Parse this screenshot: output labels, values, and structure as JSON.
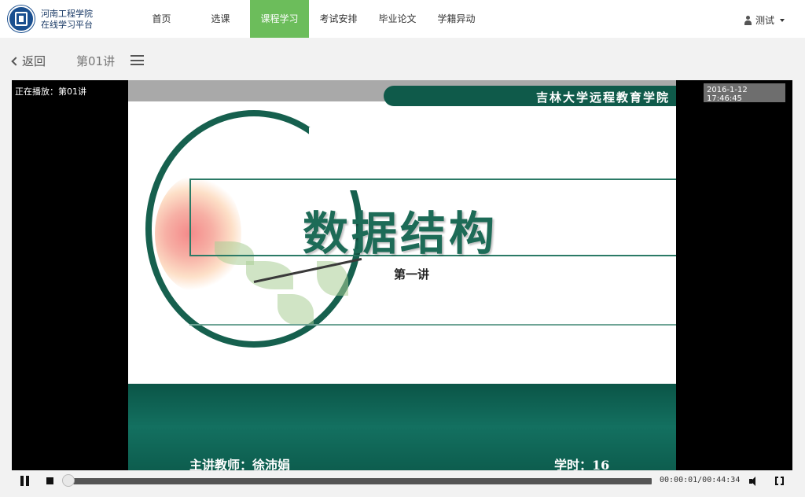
{
  "header": {
    "school_name_line1": "河南工程学院",
    "school_name_line2": "在线学习平台",
    "nav": [
      {
        "label": "首页"
      },
      {
        "label": "选课"
      },
      {
        "label": "课程学习",
        "active": true
      },
      {
        "label": "考试安排"
      },
      {
        "label": "毕业论文"
      },
      {
        "label": "学籍异动"
      }
    ],
    "user_name": "测试"
  },
  "subbar": {
    "back_label": "返回",
    "lecture_title": "第01讲"
  },
  "player": {
    "now_playing": "正在播放：第01讲",
    "timestamp": "2016-1-12 17:46:45",
    "slide": {
      "header_text": "吉林大学远程教育学院",
      "title": "数据结构",
      "subtitle": "第一讲",
      "lecturer": "主讲教师：徐沛娟",
      "hours": "学时：16"
    },
    "controls": {
      "time_readout": "00:00:01/00:44:34",
      "progress_fraction": 0.0004
    }
  },
  "colors": {
    "nav_active": "#6cbd5b",
    "slide_green": "#0f5a4a",
    "logo_blue": "#1a4f8f"
  }
}
